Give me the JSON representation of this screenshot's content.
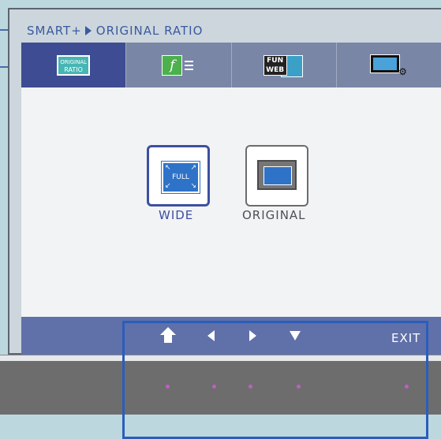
{
  "header": {
    "breadcrumb_parent": "SMART+",
    "breadcrumb_current": "ORIGINAL RATIO"
  },
  "tabs": [
    {
      "icon": "original-ratio-icon",
      "icon_text_top": "ORIGINAL",
      "icon_text_bottom": "RATIO",
      "active": true
    },
    {
      "icon": "f-engine-icon",
      "icon_text": "f",
      "active": false
    },
    {
      "icon": "fun-web-icon",
      "icon_text_top": "FUN",
      "icon_text_bottom": "WEB",
      "active": false
    },
    {
      "icon": "movie-mode-icon",
      "active": false
    }
  ],
  "options": {
    "wide": {
      "label": "WIDE",
      "badge": "FULL",
      "selected": true
    },
    "original": {
      "label": "ORIGINAL",
      "selected": false
    }
  },
  "bottom_bar": {
    "buttons": [
      "up-arrow-icon",
      "left-arrow-icon",
      "right-arrow-icon",
      "down-arrow-icon"
    ],
    "exit_label": "EXIT"
  },
  "colors": {
    "active_tab": "#3d4c93",
    "tab": "#7a86a6",
    "selected_border": "#3d4fa0",
    "bar": "#6070a8",
    "led": "#c45bc8",
    "highlight": "#2b5dbb"
  }
}
